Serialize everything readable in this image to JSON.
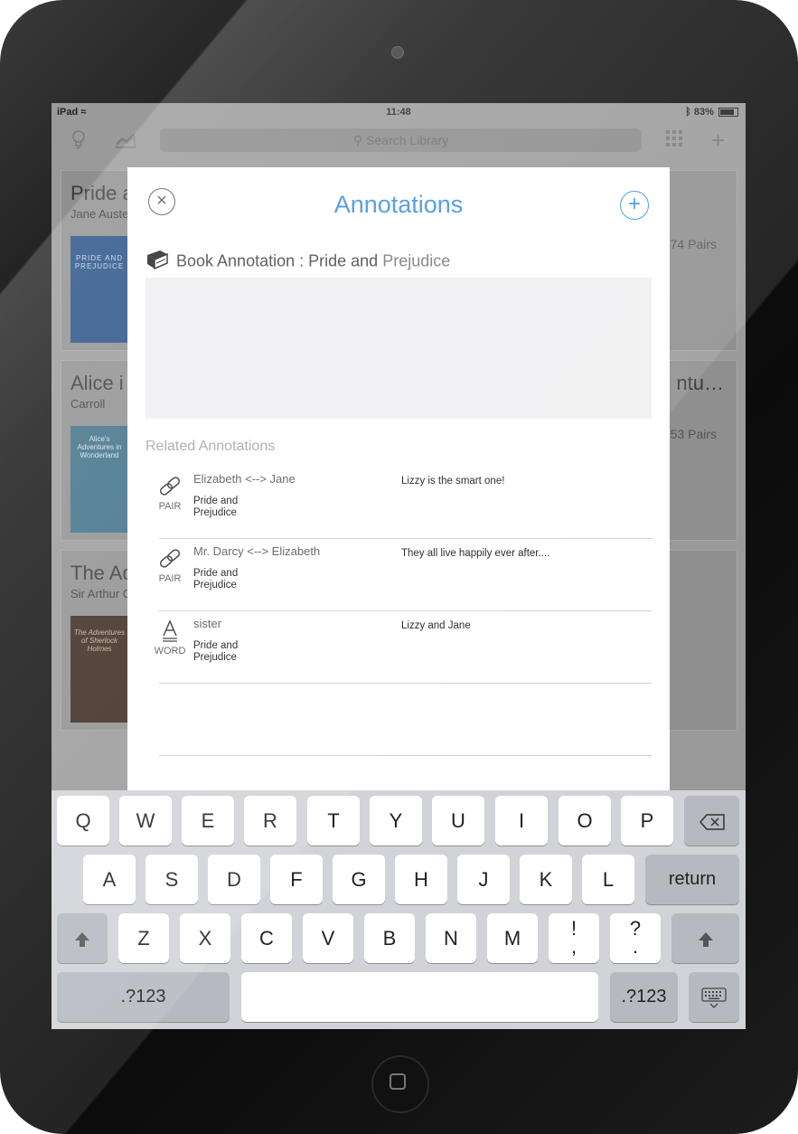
{
  "status_bar": {
    "device": "iPad",
    "time": "11:48",
    "battery": "83%"
  },
  "navbar": {
    "search_placeholder": "Search Library"
  },
  "library": [
    {
      "title": "Pride a",
      "author": "Jane Auste",
      "pairs": "74 Pairs",
      "cover_text": "PRIDE AND PREJUDICE"
    },
    {
      "title": "Alice i",
      "author": "Carroll",
      "title_right": "ntu…",
      "pairs": "53 Pairs",
      "cover_text": "Alice's Adventures in Wonderland"
    },
    {
      "title": "The Ad",
      "author": "Sir Arthur C",
      "cover_text": "The Adventures of Sherlock Holmes"
    }
  ],
  "modal": {
    "title": "Annotations",
    "book_annotation_label": "Book Annotation : Pride and",
    "book_annotation_book": "Prejudice",
    "related_label": "Related Annotations",
    "rows": [
      {
        "type": "PAIR",
        "icon": "link-icon",
        "name": "Elizabeth <--> Jane",
        "book_line1": "Pride and",
        "book_line2": "Prejudice",
        "note": "Lizzy is the smart one!"
      },
      {
        "type": "PAIR",
        "icon": "link-icon",
        "name": "Mr. Darcy <--> Elizabeth",
        "book_line1": "Pride and",
        "book_line2": "Prejudice",
        "note": "They all live happily ever after...."
      },
      {
        "type": "WORD",
        "icon": "word-icon",
        "name": "sister",
        "book_line1": "Pride and",
        "book_line2": "Prejudice",
        "note": "Lizzy and Jane"
      }
    ]
  },
  "keyboard": {
    "row1": [
      "Q",
      "W",
      "E",
      "R",
      "T",
      "Y",
      "U",
      "I",
      "O",
      "P"
    ],
    "row2": [
      "A",
      "S",
      "D",
      "F",
      "G",
      "H",
      "J",
      "K",
      "L"
    ],
    "row3": [
      "Z",
      "X",
      "C",
      "V",
      "B",
      "N",
      "M"
    ],
    "punct1": "!",
    "punct1b": ",",
    "punct2": "?",
    "punct2b": ".",
    "return_label": "return",
    "numbers_label": ".?123"
  }
}
